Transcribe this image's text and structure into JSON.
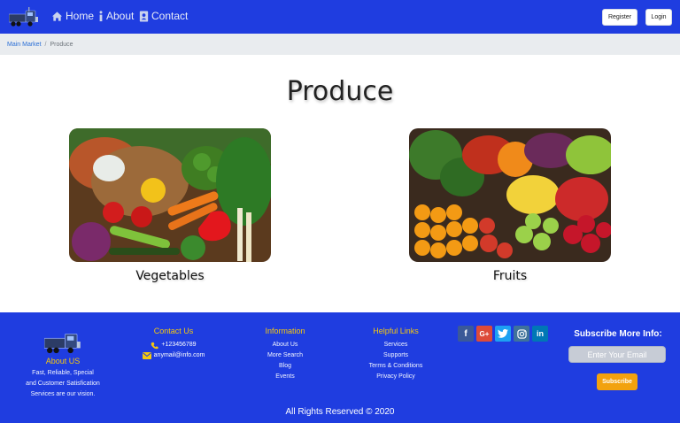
{
  "nav": {
    "home": "Home",
    "about": "About",
    "contact": "Contact",
    "register": "Register",
    "login": "Login"
  },
  "breadcrumb": {
    "parent": "Main Market",
    "separator": "/",
    "current": "Produce"
  },
  "main": {
    "title": "Produce",
    "cards": [
      {
        "label": "Vegetables"
      },
      {
        "label": "Fruits"
      }
    ]
  },
  "footer": {
    "about": {
      "title": "About US",
      "lines": [
        "Fast, Reliable, Special",
        "and Customer Satisfication",
        "Services are our vision."
      ]
    },
    "contact": {
      "title": "Contact Us",
      "phone": "+123456789",
      "email": "anymail@info.com"
    },
    "information": {
      "title": "Information",
      "links": [
        "About Us",
        "More Search",
        "Blog",
        "Events"
      ]
    },
    "helpful": {
      "title": "Helpful Links",
      "links": [
        "Services",
        "Supports",
        "Terms & Conditions",
        "Privacy Policy"
      ]
    },
    "social": [
      "facebook-icon",
      "google-plus-icon",
      "twitter-icon",
      "instagram-icon",
      "linkedin-icon"
    ],
    "subscribe": {
      "title": "Subscribe More Info:",
      "placeholder": "Enter Your Email",
      "button": "Subscribe"
    },
    "copyright": "All Rights Reserved © 2020"
  },
  "colors": {
    "primary": "#1f3de0",
    "accent": "#f6c90e",
    "button": "#f2a20e"
  }
}
